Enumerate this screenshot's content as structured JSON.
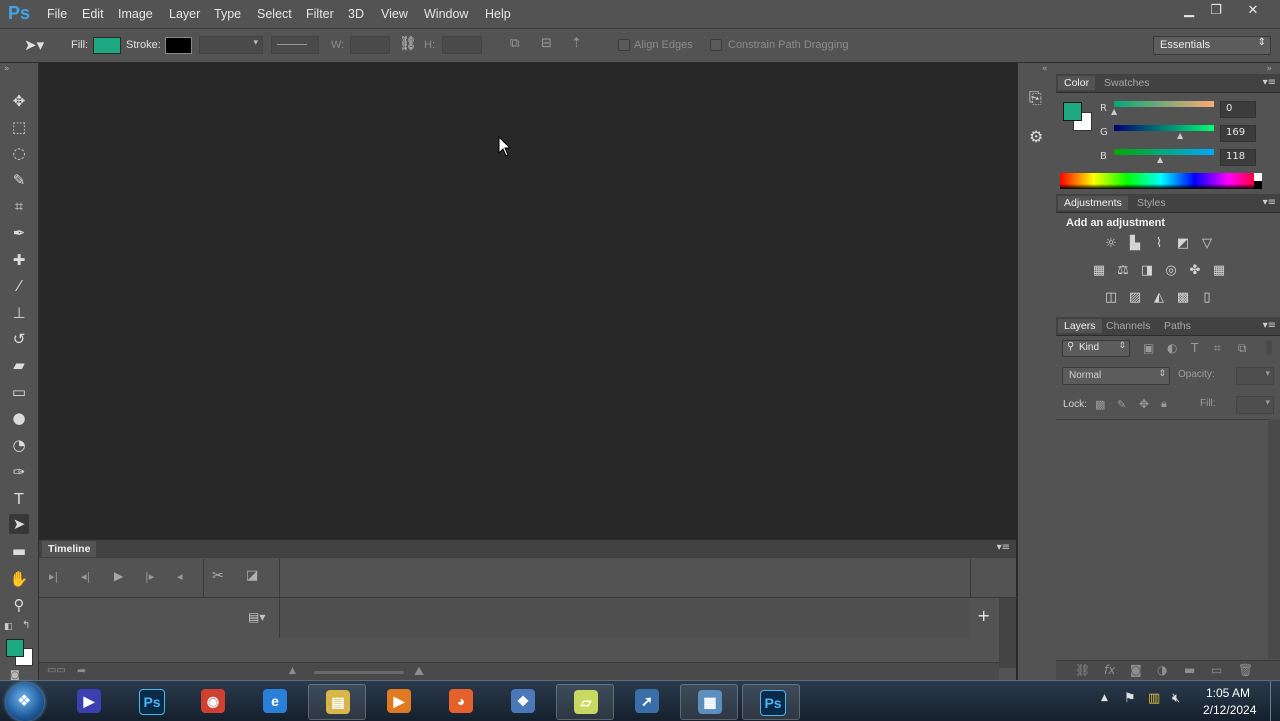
{
  "app": {
    "logo": "Ps"
  },
  "menu": [
    "File",
    "Edit",
    "Image",
    "Layer",
    "Type",
    "Select",
    "Filter",
    "3D",
    "View",
    "Window",
    "Help"
  ],
  "window_controls": {
    "minimize": "▁",
    "restore": "❐",
    "close": "✕"
  },
  "options_bar": {
    "fill_label": "Fill:",
    "fill_color": "#1ea982",
    "stroke_label": "Stroke:",
    "stroke_color": "#000000",
    "w_label": "W:",
    "h_label": "H:",
    "align_edges": "Align Edges",
    "constrain_path": "Constrain Path Dragging",
    "workspace": "Essentials"
  },
  "tools": [
    {
      "name": "move-tool-icon",
      "glyph": "✥"
    },
    {
      "name": "marquee-tool-icon",
      "glyph": "⬚"
    },
    {
      "name": "lasso-tool-icon",
      "glyph": "◌"
    },
    {
      "name": "quick-selection-tool-icon",
      "glyph": "✎"
    },
    {
      "name": "crop-tool-icon",
      "glyph": "⌗"
    },
    {
      "name": "eyedropper-tool-icon",
      "glyph": "✒"
    },
    {
      "name": "healing-brush-tool-icon",
      "glyph": "✚"
    },
    {
      "name": "brush-tool-icon",
      "glyph": "⁄"
    },
    {
      "name": "clone-stamp-tool-icon",
      "glyph": "⊥"
    },
    {
      "name": "history-brush-tool-icon",
      "glyph": "↺"
    },
    {
      "name": "eraser-tool-icon",
      "glyph": "▰"
    },
    {
      "name": "gradient-tool-icon",
      "glyph": "▭"
    },
    {
      "name": "blur-tool-icon",
      "glyph": "●"
    },
    {
      "name": "dodge-tool-icon",
      "glyph": "◔"
    },
    {
      "name": "pen-tool-icon",
      "glyph": "✑"
    },
    {
      "name": "type-tool-icon",
      "glyph": "T"
    },
    {
      "name": "path-selection-tool-icon",
      "glyph": "➤"
    },
    {
      "name": "rectangle-tool-icon",
      "glyph": "▬"
    },
    {
      "name": "hand-tool-icon",
      "glyph": "✋"
    },
    {
      "name": "zoom-tool-icon",
      "glyph": "⚲"
    }
  ],
  "colors": {
    "foreground": "#1ea982",
    "background": "#ffffff"
  },
  "timeline": {
    "title": "Timeline"
  },
  "color_panel": {
    "tabs": [
      "Color",
      "Swatches"
    ],
    "r_label": "R",
    "g_label": "G",
    "b_label": "B",
    "r": "0",
    "g": "169",
    "b": "118"
  },
  "adjustments_panel": {
    "tabs": [
      "Adjustments",
      "Styles"
    ],
    "heading": "Add an adjustment"
  },
  "layers_panel": {
    "tabs": [
      "Layers",
      "Channels",
      "Paths"
    ],
    "kind": "Kind",
    "blend_mode": "Normal",
    "opacity_label": "Opacity:",
    "lock_label": "Lock:",
    "fill_label": "Fill:"
  },
  "taskbar": {
    "time": "1:05 AM",
    "date": "2/12/2024",
    "apps": [
      {
        "name": "media-player-icon",
        "glyph": "▶",
        "color": "#3b3fb0"
      },
      {
        "name": "photoshop-pinned-icon",
        "glyph": "Ps",
        "color": "#0a2a4a"
      },
      {
        "name": "chrome-icon",
        "glyph": "◉",
        "color": "#d04030"
      },
      {
        "name": "internet-explorer-icon",
        "glyph": "e",
        "color": "#2a7fd8"
      },
      {
        "name": "file-explorer-icon",
        "glyph": "▤",
        "color": "#d9b64a"
      },
      {
        "name": "vlc-icon",
        "glyph": "▶",
        "color": "#e07a20"
      },
      {
        "name": "firefox-icon",
        "glyph": "◕",
        "color": "#e5602a"
      },
      {
        "name": "windows-media-icon",
        "glyph": "❖",
        "color": "#4a78b8"
      },
      {
        "name": "sticky-notes-icon",
        "glyph": "▱",
        "color": "#c8d860"
      },
      {
        "name": "remote-app-icon",
        "glyph": "➚",
        "color": "#3a6ea8"
      },
      {
        "name": "control-panel-icon",
        "glyph": "▦",
        "color": "#5a8fc0"
      },
      {
        "name": "photoshop-active-icon",
        "glyph": "Ps",
        "color": "#0a2a4a"
      }
    ]
  }
}
